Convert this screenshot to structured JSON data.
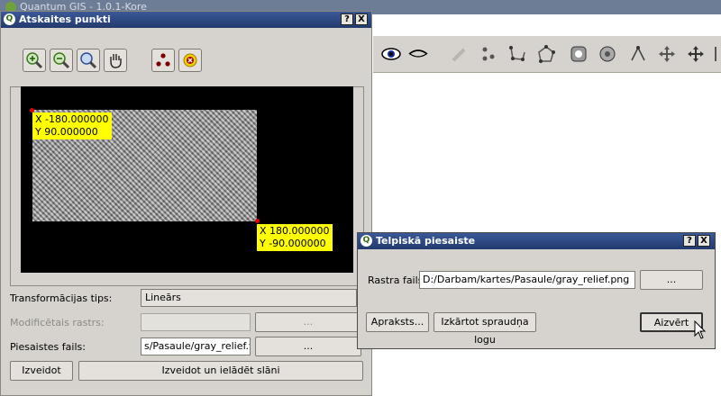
{
  "main_window": {
    "title": "Quantum GIS - 1.0.1-Kore"
  },
  "main_toolbar": {
    "icons": [
      "eye-icon",
      "eye-closed-icon",
      "pencil-icon",
      "capture-points-icon",
      "capture-line-icon",
      "capture-polygon-icon",
      "add-ring-icon",
      "add-island-icon",
      "split-icon",
      "move-icon",
      "node-tool-icon",
      "extra-icon"
    ]
  },
  "georeferencer": {
    "title": "Atskaites punkti",
    "help_btn": "?",
    "close_btn": "X",
    "tools": [
      "zoom-in-icon",
      "zoom-out-icon",
      "zoom-full-icon",
      "pan-hand-icon",
      "add-point-icon",
      "delete-point-icon"
    ],
    "labels": {
      "top_left": "X -180.000000\nY 90.000000",
      "bottom_right": "X 180.000000\nY -90.000000"
    },
    "transform_label": "Transformācijas tips:",
    "transform_value": "Lineārs",
    "modified_raster_label": "Modificētais rastrs:",
    "modified_raster_value": "",
    "browse_label": "...",
    "world_file_label": "Piesaistes fails:",
    "world_file_value": "s/Pasaule/gray_relief.wld",
    "create_btn": "Izveidot",
    "create_load_btn": "Izveidot un ielādēt slāni"
  },
  "spatial_ref": {
    "title": "Telpiskā piesaiste",
    "help_btn": "?",
    "close_btn": "X",
    "raster_label": "Rastra fails:",
    "raster_value": "D:/Darbam/kartes/Pasaule/gray_relief.png",
    "browse_label": "...",
    "description_btn": "Apraksts...",
    "arrange_btn": "Izkārtot spraudņa logu",
    "close_action_btn": "Aizvērt"
  }
}
